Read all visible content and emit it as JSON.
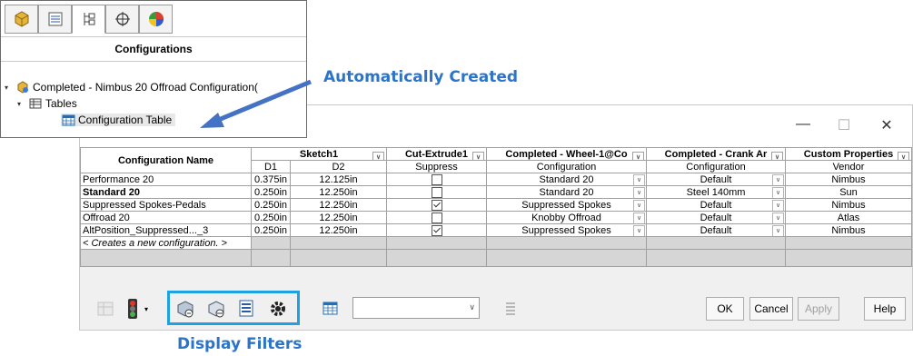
{
  "config_manager": {
    "title": "Configurations",
    "tabs": [
      "feature-manager-icon",
      "property-manager-icon",
      "configuration-manager-icon",
      "dim-xpert-icon",
      "display-manager-icon"
    ],
    "tree": {
      "root": "Completed - Nimbus 20 Offroad Configuration(",
      "tables": "Tables",
      "config_table": "Configuration Table"
    }
  },
  "annotations": {
    "auto_created": "Automatically Created",
    "display_filters": "Display Filters",
    "accent": "#2b74c8",
    "highlight": "#1fa2e0"
  },
  "window": {
    "minimize": "—",
    "maximize": "☐",
    "close": "✕"
  },
  "table": {
    "corner_header": "Configuration Name",
    "groups": [
      {
        "label": "Sketch1",
        "subs": [
          "D1",
          "D2"
        ]
      },
      {
        "label": "Cut-Extrude1",
        "subs": [
          "Suppress"
        ]
      },
      {
        "label": "Completed - Wheel-1@Co",
        "subs": [
          "Configuration"
        ]
      },
      {
        "label": "Completed - Crank Ar",
        "subs": [
          "Configuration"
        ]
      },
      {
        "label": "Custom Properties",
        "subs": [
          "Vendor"
        ]
      }
    ],
    "rows": [
      {
        "name": "Performance 20",
        "bold": false,
        "d1": "0.375in",
        "d2": "12.125in",
        "suppress": false,
        "wheel": "Standard 20",
        "crank": "Default",
        "vendor": "Nimbus"
      },
      {
        "name": "Standard 20",
        "bold": true,
        "d1": "0.250in",
        "d2": "12.250in",
        "suppress": false,
        "wheel": "Standard 20",
        "crank": "Steel 140mm",
        "vendor": "Sun"
      },
      {
        "name": "Suppressed Spokes-Pedals",
        "bold": false,
        "d1": "0.250in",
        "d2": "12.250in",
        "suppress": true,
        "wheel": "Suppressed Spokes",
        "crank": "Default",
        "vendor": "Nimbus"
      },
      {
        "name": "Offroad 20",
        "bold": false,
        "d1": "0.250in",
        "d2": "12.250in",
        "suppress": false,
        "wheel": "Knobby Offroad",
        "crank": "Default",
        "vendor": "Atlas"
      },
      {
        "name": "AltPosition_Suppressed..._3",
        "bold": false,
        "d1": "0.250in",
        "d2": "12.250in",
        "suppress": true,
        "wheel": "Suppressed Spokes",
        "crank": "Default",
        "vendor": "Nimbus"
      }
    ],
    "new_row": "< Creates a new configuration. >"
  },
  "toolbar": {
    "combo_value": "",
    "ok": "OK",
    "cancel": "Cancel",
    "apply": "Apply",
    "help": "Help"
  }
}
